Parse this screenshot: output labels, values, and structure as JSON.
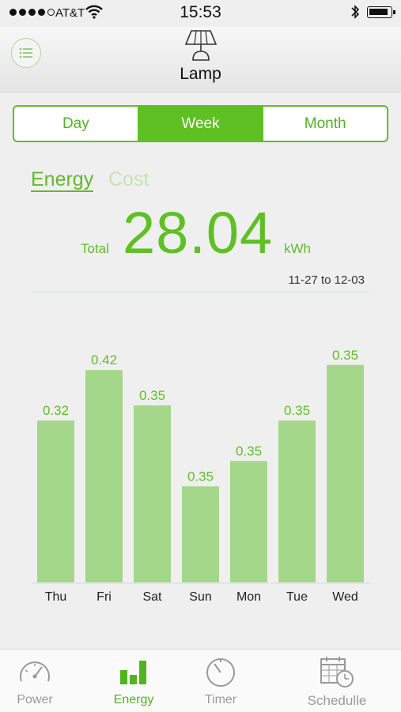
{
  "status_bar": {
    "carrier": "AT&T",
    "time": "15:53"
  },
  "header": {
    "title": "Lamp"
  },
  "range_tabs": [
    {
      "label": "Day",
      "active": false
    },
    {
      "label": "Week",
      "active": true
    },
    {
      "label": "Month",
      "active": false
    }
  ],
  "metric_tabs": {
    "energy": "Energy",
    "cost": "Cost"
  },
  "summary": {
    "total_label": "Total",
    "total_value": "28.04",
    "unit": "kWh",
    "date_range": "11-27 to 12-03"
  },
  "chart_data": {
    "type": "bar",
    "categories": [
      "Thu",
      "Fri",
      "Sat",
      "Sun",
      "Mon",
      "Tue",
      "Wed"
    ],
    "values": [
      0.32,
      0.42,
      0.35,
      0.19,
      0.24,
      0.32,
      0.43
    ],
    "value_labels": [
      "0.32",
      "0.42",
      "0.35",
      "0.35",
      "0.35",
      "0.35",
      "0.35"
    ],
    "grid": false,
    "bar_color": "#a5d78a"
  },
  "bottom_nav": [
    {
      "label": "Power",
      "icon": "gauge-icon",
      "active": false
    },
    {
      "label": "Energy",
      "icon": "bar-chart-icon",
      "active": true
    },
    {
      "label": "Timer",
      "icon": "timer-icon",
      "active": false
    },
    {
      "label": "Schedulle",
      "icon": "calendar-clock-icon",
      "active": false
    }
  ],
  "colors": {
    "accent": "#5ec023",
    "bar": "#a5d78a",
    "inactive_text": "#9a9a9a"
  }
}
